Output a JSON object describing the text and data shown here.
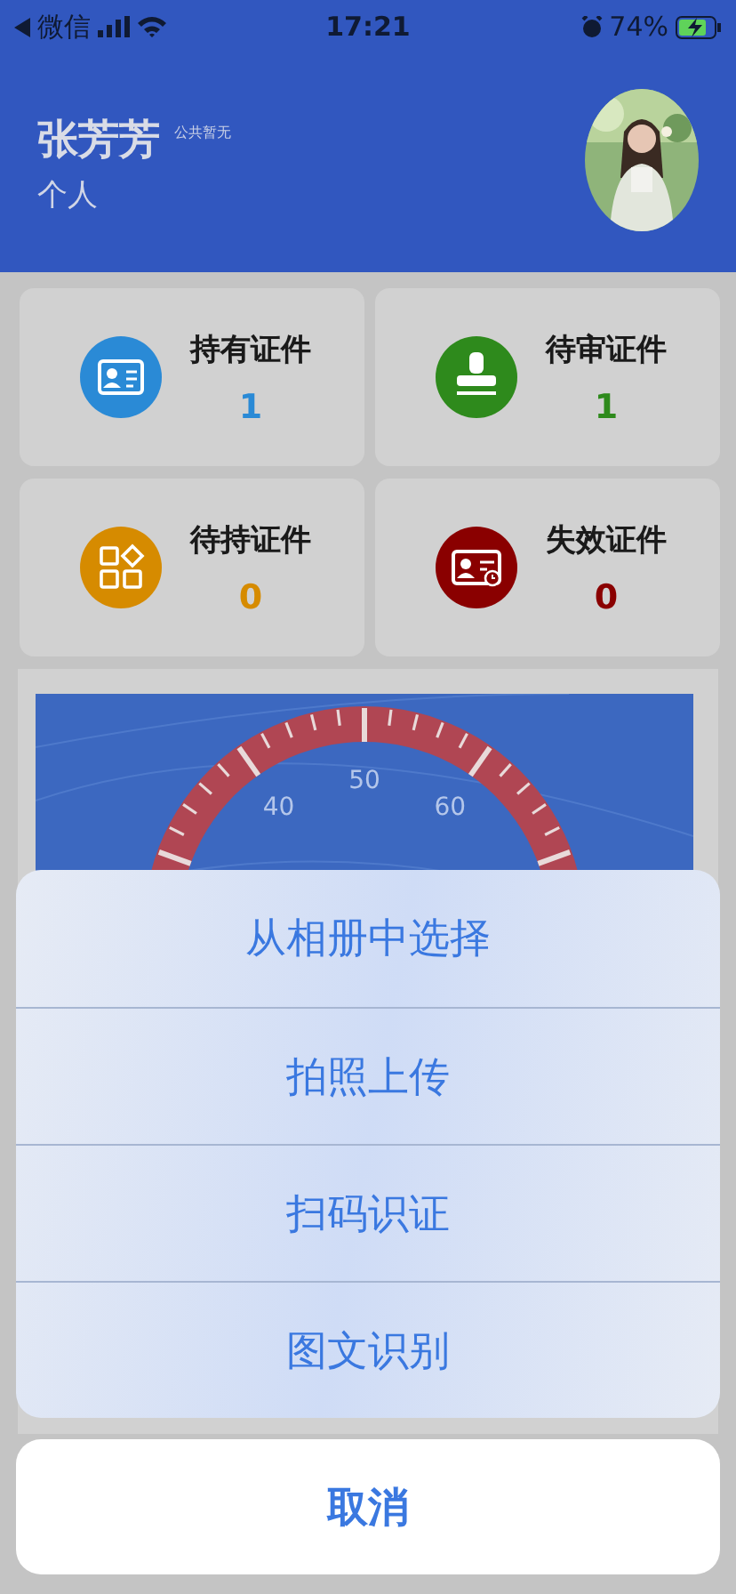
{
  "status_bar": {
    "back_label": "微信",
    "time": "17:21",
    "battery": "74%"
  },
  "profile": {
    "name": "张芳芳",
    "tag": "公共暂无",
    "type": "个人"
  },
  "cards": [
    {
      "label": "持有证件",
      "count": "1",
      "color": "#2a8ad6",
      "kind": "id-card"
    },
    {
      "label": "待审证件",
      "count": "1",
      "color": "#2e8a1c",
      "kind": "stamp"
    },
    {
      "label": "待持证件",
      "count": "0",
      "color": "#d68b00",
      "kind": "grid"
    },
    {
      "label": "失效证件",
      "count": "0",
      "color": "#8a0000",
      "kind": "expired-card"
    }
  ],
  "gauge": {
    "tick_labels": [
      "40",
      "50",
      "60"
    ]
  },
  "action_sheet": {
    "options": [
      "从相册中选择",
      "拍照上传",
      "扫码识证",
      "图文识别"
    ],
    "cancel": "取消"
  }
}
